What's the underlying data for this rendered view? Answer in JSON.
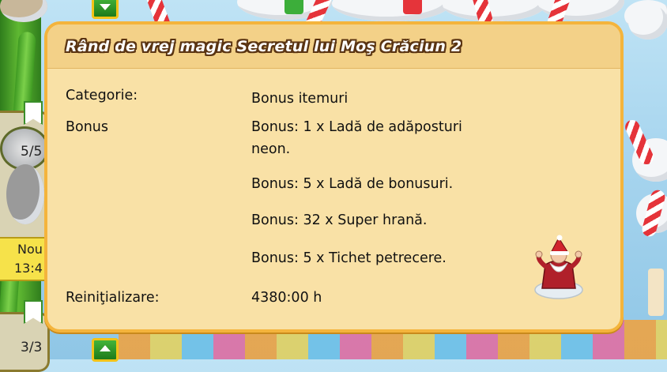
{
  "panel": {
    "title": "Rând de vrej magic Secretul lui Moş Crăciun 2",
    "rows": [
      {
        "label": "Categorie:",
        "values": [
          "Bonus itemuri"
        ]
      },
      {
        "label": "Bonus",
        "values": [
          "Bonus: 1 x Ladă de adăposturi neon.",
          "Bonus: 5 x Ladă de bonusuri.",
          "Bonus: 32 x Super hrană.",
          "Bonus: 5 x Tichet petrecere."
        ]
      },
      {
        "label": "Reiniţializare:",
        "values": [
          "4380:00 h"
        ]
      }
    ],
    "icon": "santa-bonus-icon"
  },
  "sidebar": {
    "slot_counts": [
      "5/5",
      "3/3"
    ],
    "time_tag_lines": [
      "Nou",
      "13:4"
    ]
  },
  "colors": {
    "panel_bg": "#f9e1a6",
    "panel_border": "#f4b43c",
    "title_outline": "#5a3412"
  }
}
